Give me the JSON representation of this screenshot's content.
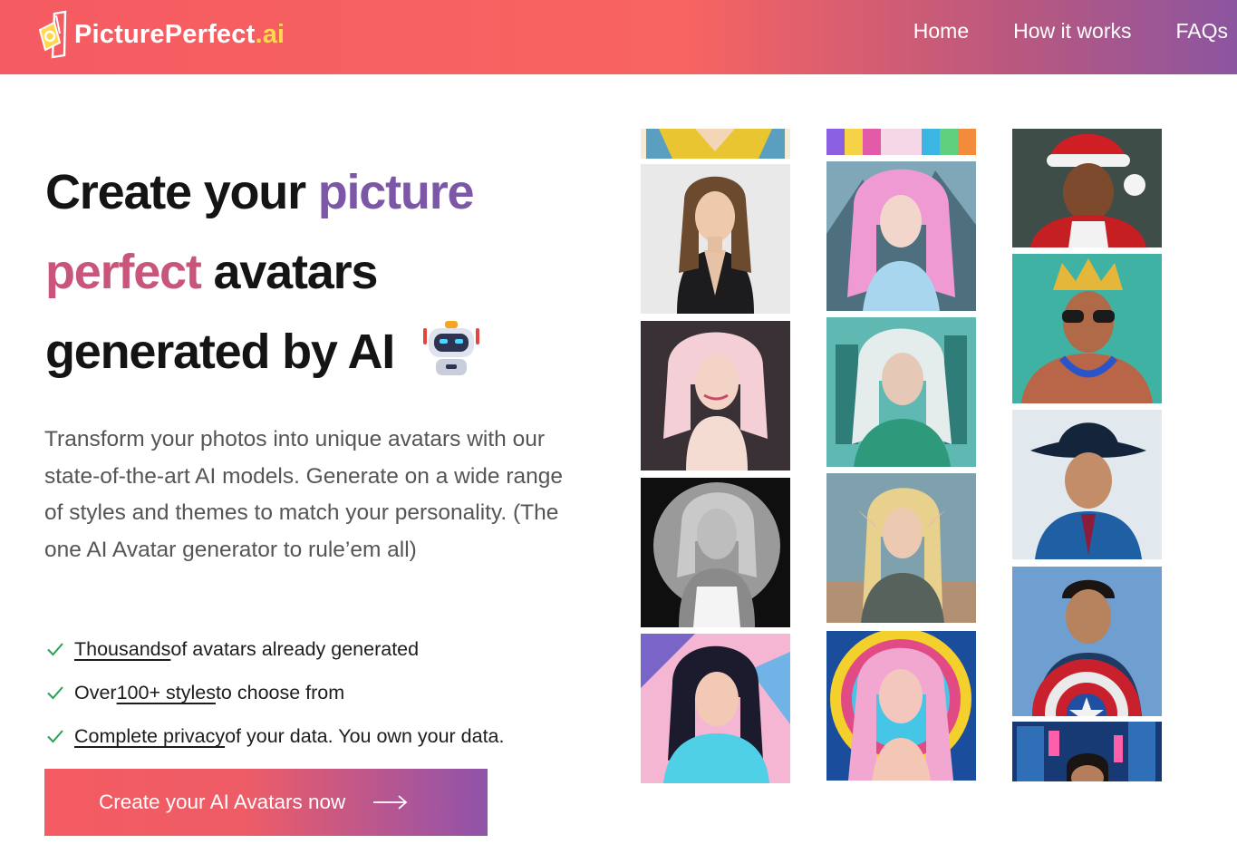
{
  "brand": {
    "name": "PicturePerfect",
    "tld": ".ai",
    "logo_icon": "camera-tag-icon"
  },
  "nav": {
    "items": [
      "Home",
      "How it works",
      "FAQs"
    ]
  },
  "hero": {
    "headline": {
      "line1_a": "Create your ",
      "line1_b": "picture",
      "line2_a": "perfect",
      "line2_b": " avatars",
      "line3": "generated by AI",
      "emoji_icon": "robot-icon"
    },
    "description": "Transform your photos into unique avatars with our state-of-the-art AI models. Generate on a wide range of styles and themes to match your personality. (The one AI Avatar generator to rule’em all)",
    "features": [
      {
        "link": "Thousands",
        "text": " of avatars already generated",
        "prefix": ""
      },
      {
        "prefix": "Over ",
        "link": "100+ styles",
        "text": " to choose from"
      },
      {
        "link": "Complete privacy",
        "text": " of your data. You own your data.",
        "prefix": ""
      }
    ],
    "cta_label": "Create your AI Avatars now",
    "cta_icon": "arrow-right-icon"
  },
  "gallery": {
    "columns": [
      [
        "avatar-gold-dress-partial",
        "avatar-woman-blazer",
        "avatar-woman-pink-hair-studio",
        "avatar-woman-bw-portrait",
        "avatar-woman-pop-art"
      ],
      [
        "avatar-rainbow-hair-partial",
        "avatar-fantasy-pink-hair",
        "avatar-silver-hair-warrior",
        "avatar-elf-armor",
        "avatar-psychedelic-rainbow"
      ],
      [
        "avatar-man-santa-hat",
        "avatar-man-king-sunglasses",
        "avatar-man-cowboy-hat",
        "avatar-man-captain-shield",
        "avatar-man-neon-city-partial"
      ]
    ]
  },
  "colors": {
    "brand_coral": "#f55b62",
    "brand_purple": "#8c55a0",
    "accent_yellow": "#ffd84d",
    "check_green": "#2e9e57"
  }
}
